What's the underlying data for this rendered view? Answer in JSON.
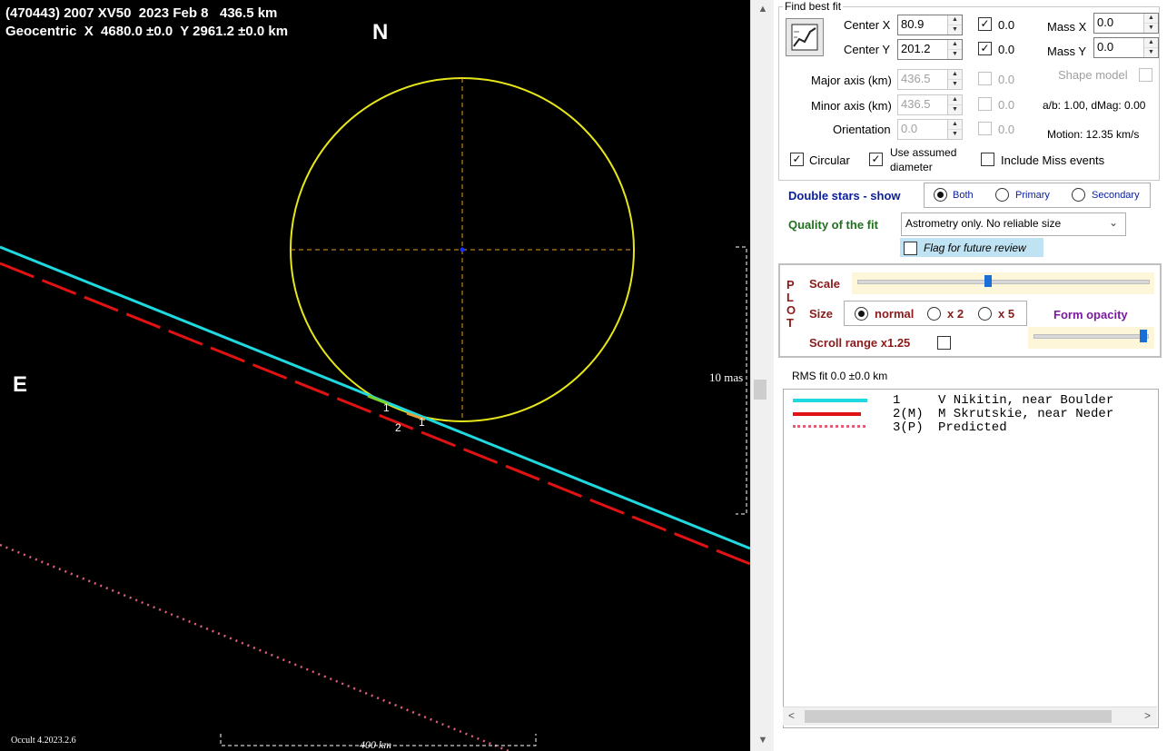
{
  "plot": {
    "header_line1": "(470443) 2007 XV50  2023 Feb 8   436.5 km",
    "header_line2": "Geocentric  X  4680.0 ±0.0  Y 2961.2 ±0.0 km",
    "north_label": "N",
    "east_label": "E",
    "scale_mas_label": "10 mas",
    "scale_km_label": "400 km",
    "version_label": "Occult 4.2023.2.6",
    "chord_labels": [
      "1",
      "2",
      "1"
    ],
    "colors": {
      "ellipse": "#e6e619",
      "axes": "#e69b1a",
      "chord1": "#1fd9e0",
      "chord2": "#e01212",
      "predicted": "#e0607a"
    }
  },
  "scrollbar": {
    "up_icon": "▲",
    "down_icon": "▼"
  },
  "fit": {
    "group_title": "Find best fit",
    "center_x_label": "Center X",
    "center_x_value": "80.9",
    "center_x_check": "0.0",
    "center_y_label": "Center Y",
    "center_y_value": "201.2",
    "center_y_check": "0.0",
    "mass_x_label": "Mass X",
    "mass_x_value": "0.0",
    "mass_y_label": "Mass Y",
    "mass_y_value": "0.0",
    "shape_model_label": "Shape model",
    "major_label": "Major axis (km)",
    "major_value": "436.5",
    "major_check": "0.0",
    "minor_label": "Minor axis (km)",
    "minor_value": "436.5",
    "minor_check": "0.0",
    "orientation_label": "Orientation",
    "orientation_value": "0.0",
    "orientation_check": "0.0",
    "ab_text": "a/b: 1.00, dMag: 0.00",
    "motion_text": "Motion: 12.35 km/s",
    "circular_label": "Circular",
    "assumed_label_1": "Use assumed",
    "assumed_label_2": "diameter",
    "miss_label": "Include Miss events"
  },
  "double_stars": {
    "label": "Double stars - show",
    "options": [
      "Both",
      "Primary",
      "Secondary"
    ],
    "selected": "Both"
  },
  "quality": {
    "label": "Quality of the fit",
    "value": "Astrometry only. No reliable size",
    "flag_label": "Flag for future review"
  },
  "plot_box": {
    "vertical_title": [
      "P",
      "L",
      "O",
      "T"
    ],
    "scale_label": "Scale",
    "size_label": "Size",
    "size_options": [
      "normal",
      "x 2",
      "x 5"
    ],
    "size_selected": "normal",
    "opacity_label": "Form opacity",
    "scroll_range_label": "Scroll range x1.25",
    "scale_slider_fraction": 0.45,
    "opacity_slider_fraction": 1.0
  },
  "rms_text": "RMS fit 0.0 ±0.0 km",
  "legend": [
    {
      "num": "1",
      "name": "V Nikitin, near Boulder"
    },
    {
      "num": "2(M)",
      "name": "M Skrutskie, near Neder"
    },
    {
      "num": "3(P)",
      "name": "Predicted"
    }
  ]
}
